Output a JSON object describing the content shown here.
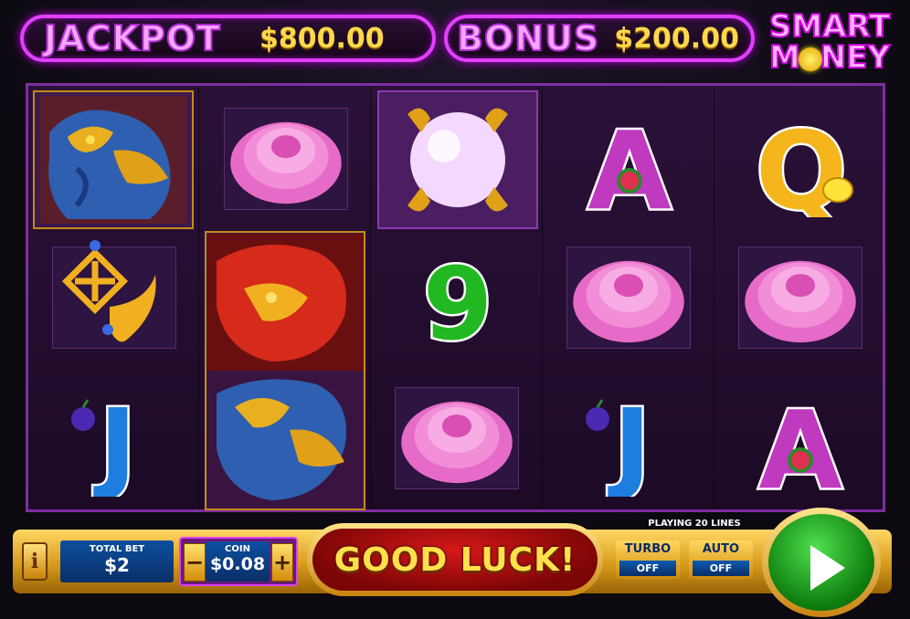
{
  "jackpot": {
    "label": "JACKPOT",
    "value": "$800.00"
  },
  "bonus": {
    "label": "BONUS",
    "value": "$200.00"
  },
  "logo": {
    "line1": "SMART",
    "line2a": "M",
    "line2b": "NEY"
  },
  "reels": {
    "col1": [
      "blue-dragon",
      "golden-knot",
      "J"
    ],
    "col2": [
      "peony",
      "red-blue-dragon-stacked"
    ],
    "col3": [
      "pearl",
      "9",
      "peony"
    ],
    "col4": [
      "A",
      "peony",
      "J"
    ],
    "col5": [
      "Q",
      "peony",
      "A"
    ]
  },
  "letters": {
    "a": "A",
    "q": "Q",
    "j": "J",
    "nine": "9"
  },
  "controls": {
    "info": "i",
    "total_bet_label": "TOTAL BET",
    "total_bet_value": "$2",
    "coin_label": "COIN",
    "coin_value": "$0.08",
    "minus": "−",
    "plus": "+",
    "good_luck": "GOOD LUCK!",
    "playing": "PLAYING 20 LINES",
    "turbo_label": "TURBO",
    "turbo_state": "OFF",
    "auto_label": "AUTO",
    "auto_state": "OFF"
  },
  "colors": {
    "accent": "#e040fb",
    "gold": "#ffd84a",
    "spin_green": "#1aa31a"
  }
}
